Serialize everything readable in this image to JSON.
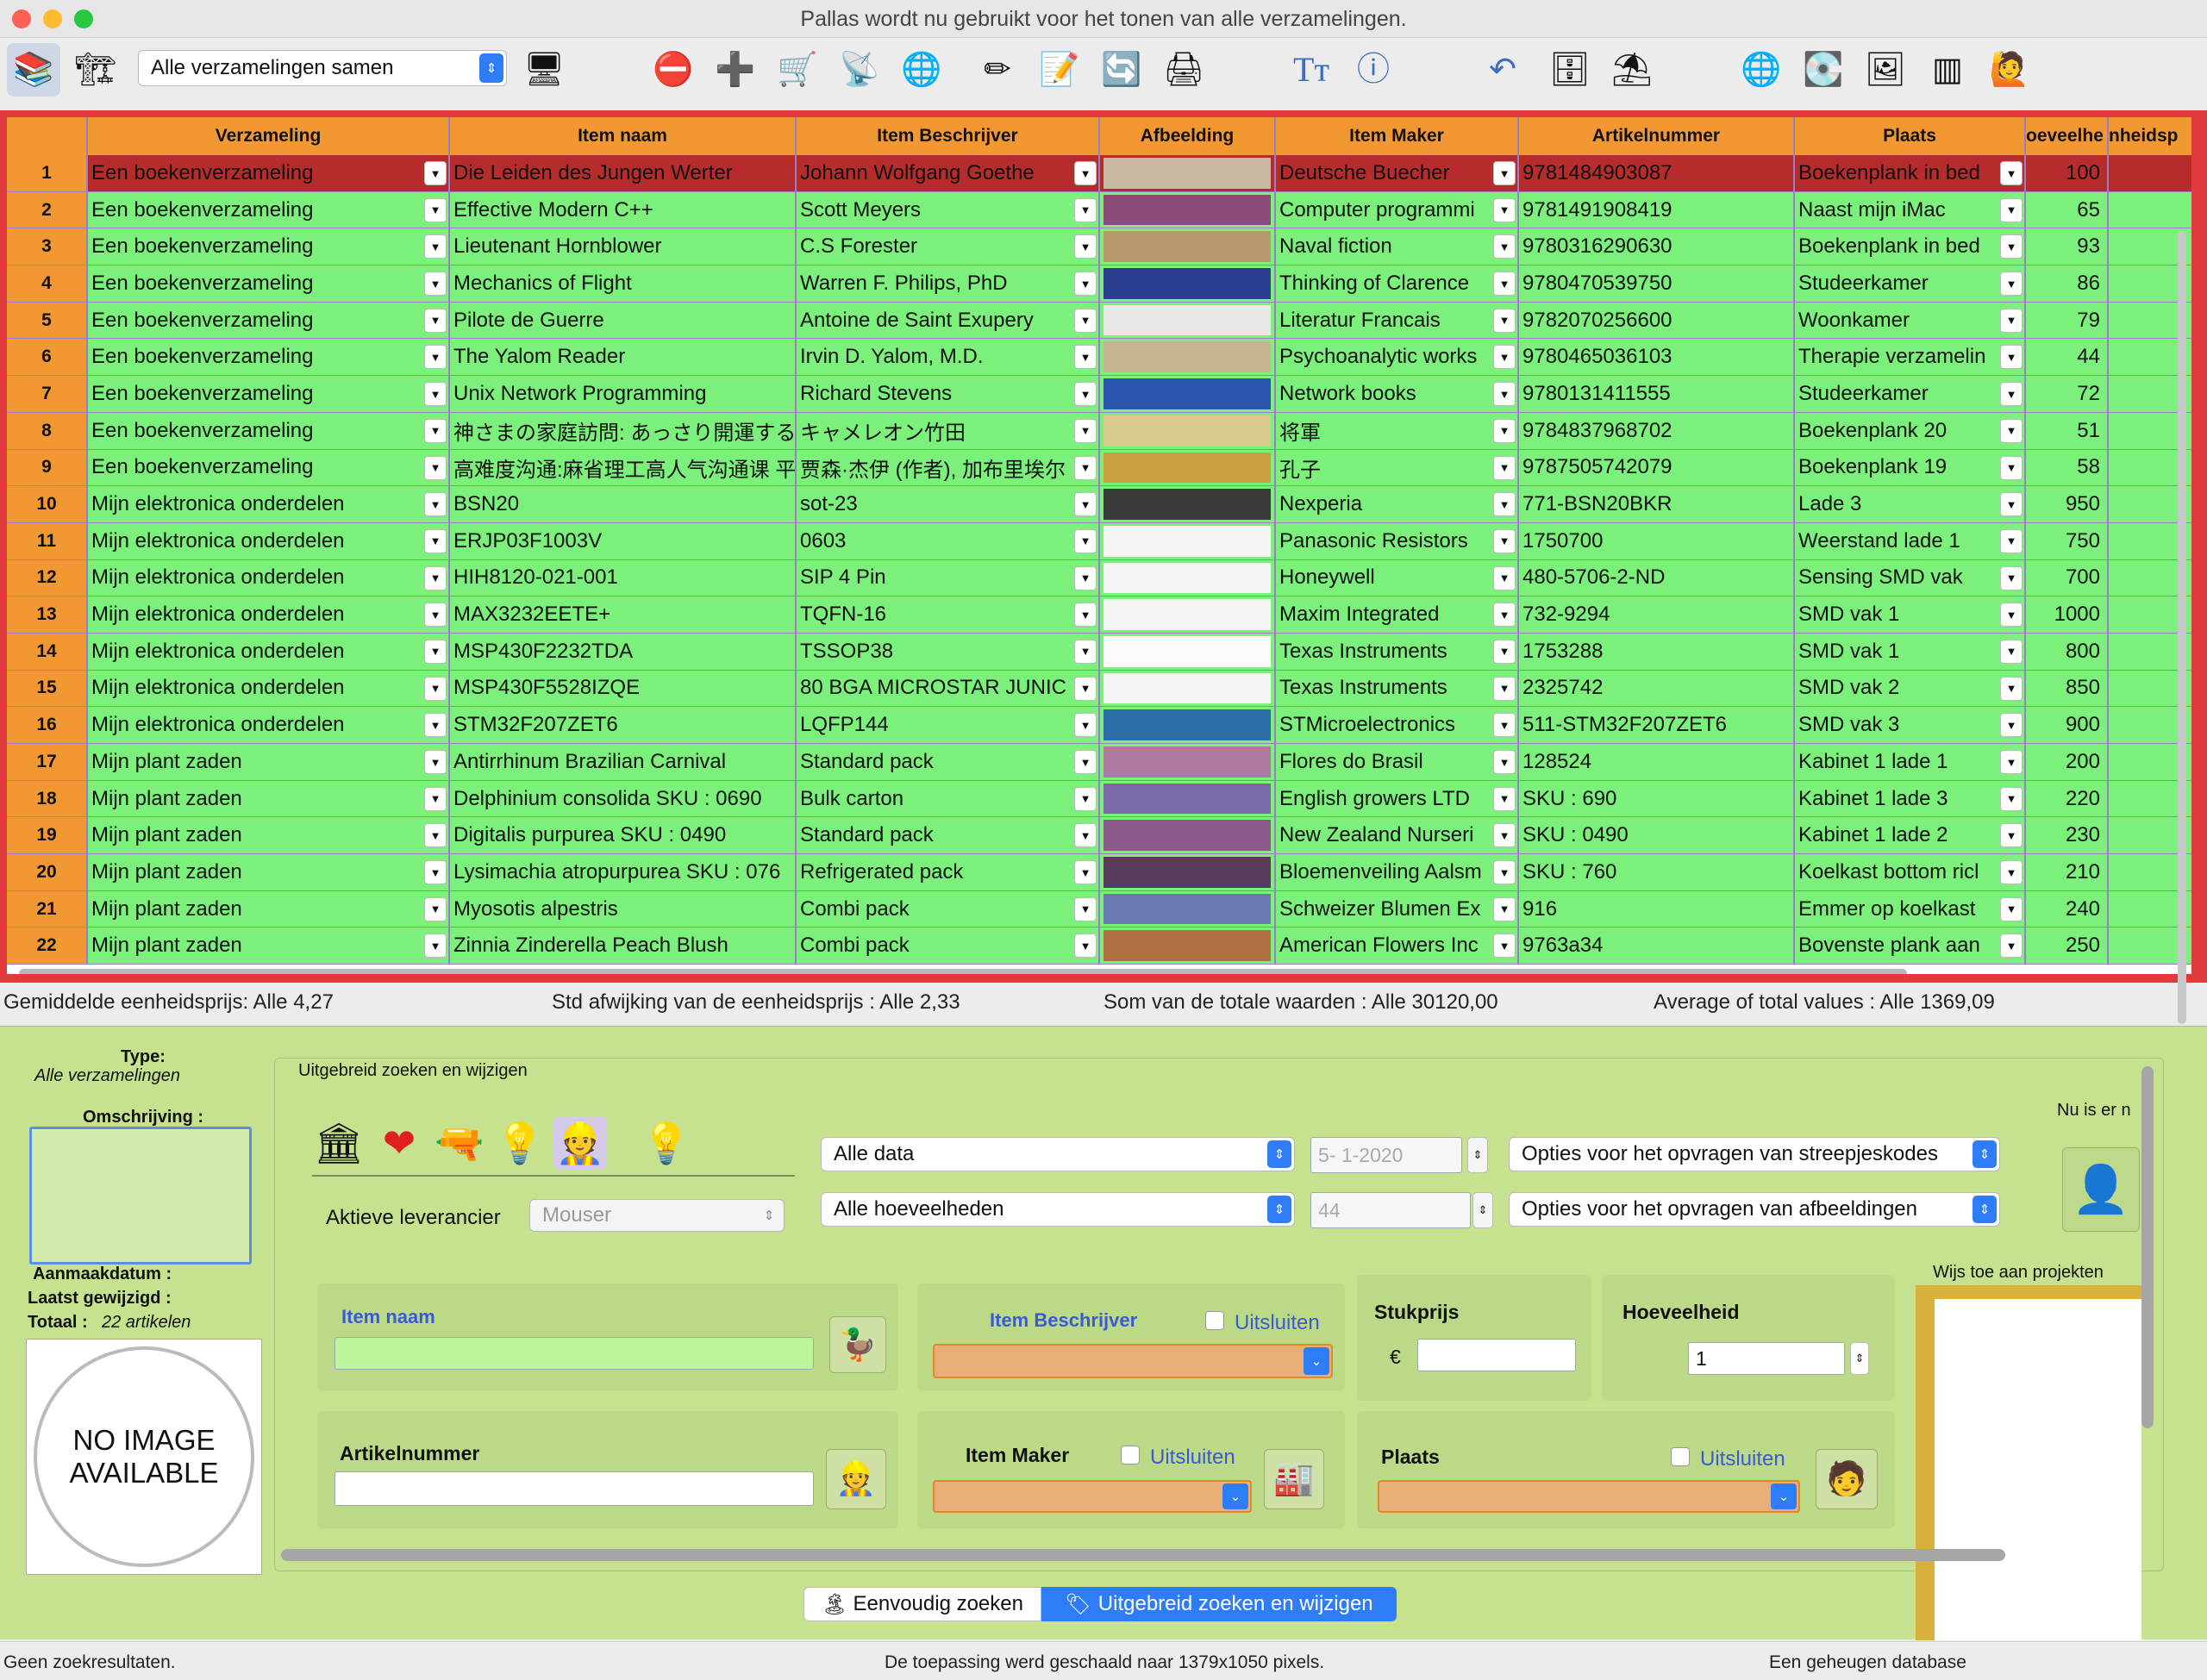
{
  "window": {
    "title": "Pallas wordt nu gebruikt voor het tonen van alle verzamelingen."
  },
  "toolbar": {
    "collection_select": "Alle verzamelingen samen"
  },
  "colors": {
    "header": "#f29833",
    "row": "#7bf07b",
    "selected_row": "#b62b2b",
    "grid_border": "#e23a3a",
    "panel": "#c6e28f",
    "accent": "#2f7df6"
  },
  "table": {
    "columns": [
      "",
      "Verzameling",
      "Item naam",
      "Item Beschrijver",
      "Afbeelding",
      "Item Maker",
      "Artikelnummer",
      "Plaats",
      "oeveelhe",
      "nheidsp"
    ],
    "rows": [
      {
        "n": "1",
        "coll": "Een boekenverzameling",
        "name": "Die Leiden des Jungen Werter",
        "desc": "Johann Wolfgang Goethe",
        "maker": "Deutsche Buecher",
        "art": "9781484903087",
        "place": "Boekenplank in bed",
        "qty": "100"
      },
      {
        "n": "2",
        "coll": "Een boekenverzameling",
        "name": "Effective Modern C++",
        "desc": "Scott Meyers",
        "maker": "Computer programmi",
        "art": "9781491908419",
        "place": "Naast mijn iMac",
        "qty": "65"
      },
      {
        "n": "3",
        "coll": "Een boekenverzameling",
        "name": "Lieutenant Hornblower",
        "desc": "C.S Forester",
        "maker": "Naval fiction",
        "art": "9780316290630",
        "place": "Boekenplank in bed",
        "qty": "93"
      },
      {
        "n": "4",
        "coll": "Een boekenverzameling",
        "name": "Mechanics of Flight",
        "desc": "Warren F. Philips, PhD",
        "maker": "Thinking of Clarence",
        "art": "9780470539750",
        "place": "Studeerkamer",
        "qty": "86"
      },
      {
        "n": "5",
        "coll": "Een boekenverzameling",
        "name": "Pilote de Guerre",
        "desc": "Antoine de Saint Exupery",
        "maker": "Literatur Francais",
        "art": "9782070256600",
        "place": "Woonkamer",
        "qty": "79"
      },
      {
        "n": "6",
        "coll": "Een boekenverzameling",
        "name": "The Yalom Reader",
        "desc": "Irvin D. Yalom, M.D.",
        "maker": "Psychoanalytic works",
        "art": "9780465036103",
        "place": "Therapie verzamelin",
        "qty": "44"
      },
      {
        "n": "7",
        "coll": "Een boekenverzameling",
        "name": "Unix Network Programming",
        "desc": "Richard Stevens",
        "maker": "Network books",
        "art": "9780131411555",
        "place": "Studeerkamer",
        "qty": "72"
      },
      {
        "n": "8",
        "coll": "Een boekenverzameling",
        "name": "神さまの家庭訪問: あっさり開運する",
        "desc": "キャメレオン竹田",
        "maker": "将軍",
        "art": "9784837968702",
        "place": "Boekenplank 20",
        "qty": "51"
      },
      {
        "n": "9",
        "coll": "Een boekenverzameling",
        "name": "高难度沟通:麻省理工高人气沟通课 平",
        "desc": "贾森·杰伊 (作者), 加布里埃尔",
        "maker": "孔子",
        "art": "9787505742079",
        "place": "Boekenplank 19",
        "qty": "58"
      },
      {
        "n": "10",
        "coll": "Mijn elektronica onderdelen",
        "name": "BSN20",
        "desc": "sot-23",
        "maker": "Nexperia",
        "art": "771-BSN20BKR",
        "place": "Lade 3",
        "qty": "950"
      },
      {
        "n": "11",
        "coll": "Mijn elektronica onderdelen",
        "name": "ERJP03F1003V",
        "desc": "0603",
        "maker": "Panasonic Resistors",
        "art": "1750700",
        "place": "Weerstand lade 1",
        "qty": "750"
      },
      {
        "n": "12",
        "coll": "Mijn elektronica onderdelen",
        "name": "HIH8120-021-001",
        "desc": "SIP 4 Pin",
        "maker": "Honeywell",
        "art": "480-5706-2-ND",
        "place": "Sensing SMD vak",
        "qty": "700"
      },
      {
        "n": "13",
        "coll": "Mijn elektronica onderdelen",
        "name": "MAX3232EETE+",
        "desc": "TQFN-16",
        "maker": "Maxim Integrated",
        "art": "732-9294",
        "place": "SMD vak 1",
        "qty": "1000"
      },
      {
        "n": "14",
        "coll": "Mijn elektronica onderdelen",
        "name": "MSP430F2232TDA",
        "desc": "TSSOP38",
        "maker": "Texas Instruments",
        "art": "1753288",
        "place": "SMD vak 1",
        "qty": "800"
      },
      {
        "n": "15",
        "coll": "Mijn elektronica onderdelen",
        "name": "MSP430F5528IZQE",
        "desc": "80 BGA MICROSTAR JUNIC",
        "maker": "Texas Instruments",
        "art": "2325742",
        "place": "SMD vak 2",
        "qty": "850"
      },
      {
        "n": "16",
        "coll": "Mijn elektronica onderdelen",
        "name": "STM32F207ZET6",
        "desc": "LQFP144",
        "maker": "STMicroelectronics",
        "art": "511-STM32F207ZET6",
        "place": "SMD vak 3",
        "qty": "900"
      },
      {
        "n": "17",
        "coll": "Mijn plant zaden",
        "name": "Antirrhinum Brazilian Carnival",
        "desc": "Standard pack",
        "maker": "Flores do Brasil",
        "art": "128524",
        "place": "Kabinet 1 lade 1",
        "qty": "200"
      },
      {
        "n": "18",
        "coll": "Mijn plant zaden",
        "name": "Delphinium consolida SKU : 0690",
        "desc": "Bulk carton",
        "maker": "English growers LTD",
        "art": "SKU : 690",
        "place": "Kabinet 1 lade 3",
        "qty": "220"
      },
      {
        "n": "19",
        "coll": "Mijn plant zaden",
        "name": "Digitalis purpurea SKU : 0490",
        "desc": "Standard pack",
        "maker": "New Zealand Nurseri",
        "art": "SKU : 0490",
        "place": "Kabinet 1 lade 2",
        "qty": "230"
      },
      {
        "n": "20",
        "coll": "Mijn plant zaden",
        "name": "Lysimachia atropurpurea SKU : 076",
        "desc": "Refrigerated pack",
        "maker": "Bloemenveiling Aalsm",
        "art": "SKU : 760",
        "place": "Koelkast bottom ricl",
        "qty": "210"
      },
      {
        "n": "21",
        "coll": "Mijn plant zaden",
        "name": "Myosotis alpestris",
        "desc": "Combi pack",
        "maker": "Schweizer Blumen Ex",
        "art": "916",
        "place": "Emmer op koelkast",
        "qty": "240"
      },
      {
        "n": "22",
        "coll": "Mijn plant zaden",
        "name": "Zinnia Zinderella Peach Blush",
        "desc": "Combi pack",
        "maker": "American Flowers Inc",
        "art": "9763a34",
        "place": "Bovenste plank aan",
        "qty": "250"
      }
    ]
  },
  "stats": {
    "avg": "Gemiddelde eenheidsprijs:  Alle 4,27",
    "std": "Std afwijking van de eenheidsprijs :  Alle 2,33",
    "sum": "Som van de totale waarden :  Alle 30120,00",
    "avgtotal": "Average of total values :  Alle 1369,09"
  },
  "left_panel": {
    "type_label": "Type:",
    "type_value": "Alle verzamelingen",
    "desc_label": "Omschrijving :",
    "created": "Aanmaakdatum :",
    "modified": "Laatst gewijzigd :",
    "total_label": "Totaal  :",
    "total_value": "22 artikelen",
    "no_image_line1": "NO IMAGE",
    "no_image_line2": "AVAILABLE"
  },
  "search": {
    "group_title": "Uitgebreid zoeken en wijzigen",
    "data_select": "Alle data",
    "date_value": "5-  1-2020",
    "barcode_select": "Opties voor het opvragen van streepjeskodes",
    "qty_select": "Alle hoeveelheden",
    "qty_value": "44",
    "image_select": "Opties voor het opvragen van afbeeldingen",
    "supplier_label": "Aktieve leverancier",
    "supplier_value": "Mouser",
    "now_label": "Nu is er n",
    "projects_label": "Wijs toe aan projekten",
    "item_name_label": "Item naam",
    "item_desc_label": "Item Beschrijver",
    "exclude": "Uitsluiten",
    "price_label": "Stukprijs",
    "currency": "€",
    "qty_label": "Hoeveelheid",
    "qty_input": "1",
    "article_label": "Artikelnummer",
    "maker_label": "Item Maker",
    "place_label": "Plaats"
  },
  "tabs": {
    "simple": "Eenvoudig zoeken",
    "advanced": "Uitgebreid zoeken en wijzigen"
  },
  "footer": {
    "left": "Geen zoekresultaten.",
    "center": "De toepassing werd geschaald naar 1379x1050 pixels.",
    "right": "Een geheugen database"
  }
}
